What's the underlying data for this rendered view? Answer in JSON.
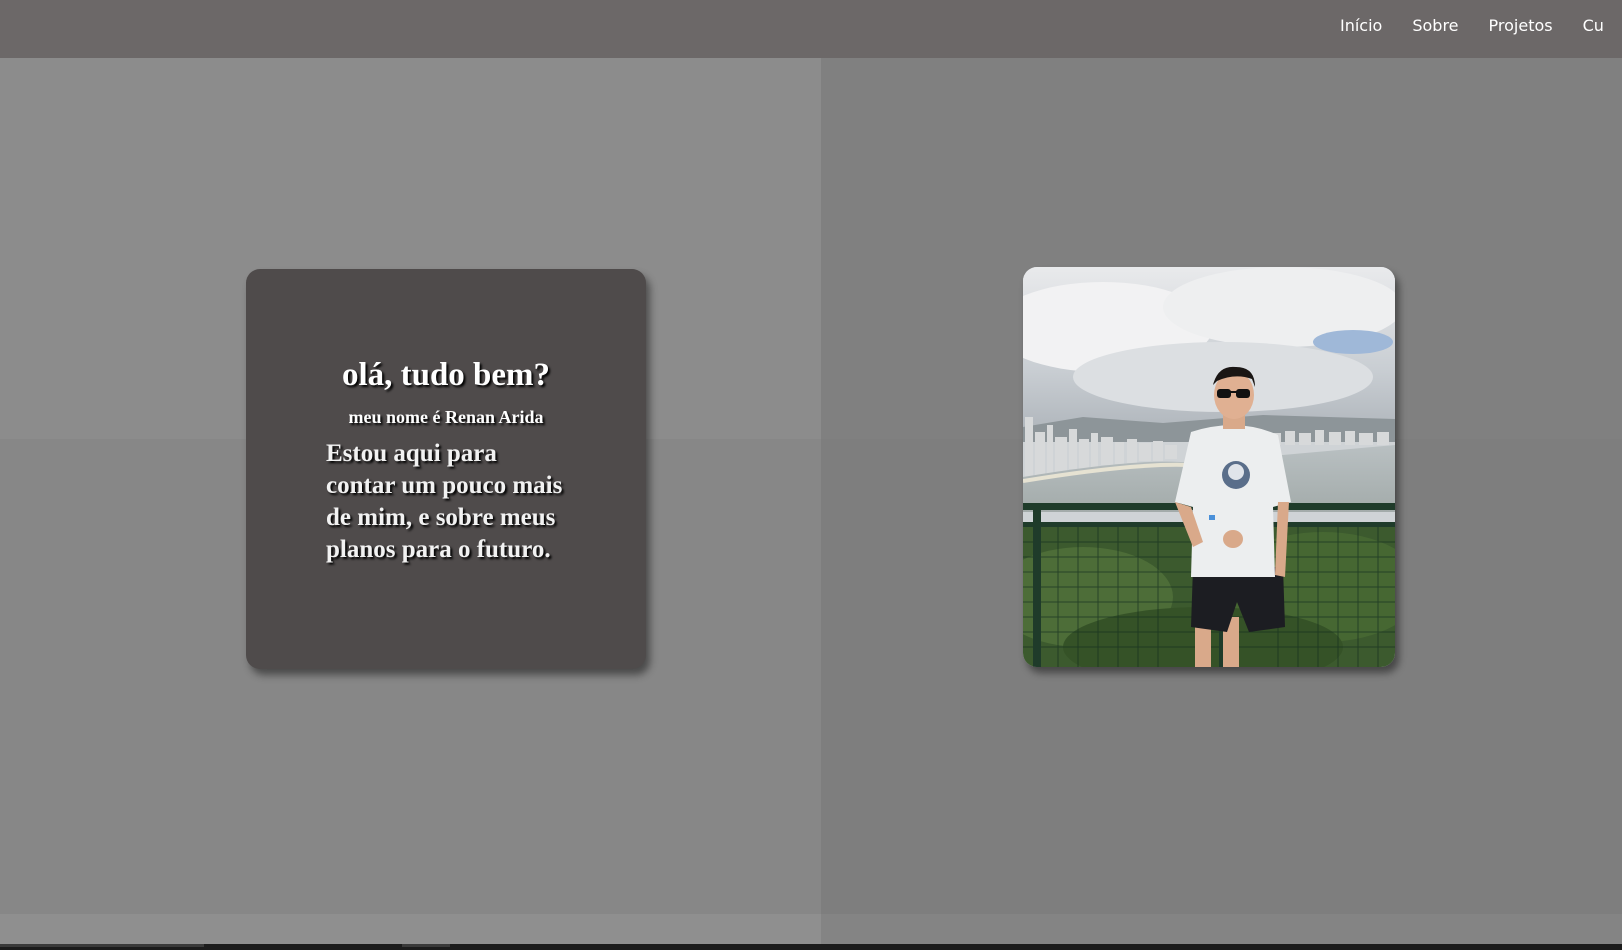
{
  "nav": {
    "items": [
      {
        "label": "Início"
      },
      {
        "label": "Sobre"
      },
      {
        "label": "Projetos"
      },
      {
        "label": "Cu"
      }
    ]
  },
  "hero": {
    "title": "olá, tudo bem?",
    "subtitle": "meu nome é Renan Arida",
    "body": "Estou aqui para contar um pouco mais de mim, e sobre meus planos para o futuro."
  },
  "photo": {
    "icon": "profile-photo"
  },
  "colors": {
    "navbar": "#6c6868",
    "card": "#4f4b4b",
    "text": "#ffffff"
  }
}
